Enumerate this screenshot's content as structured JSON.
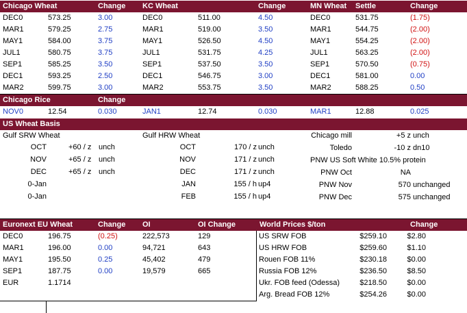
{
  "futures": {
    "headers": [
      "Chicago Wheat",
      "Change",
      "KC Wheat",
      "Change",
      "MN Wheat",
      "Settle",
      "Change"
    ],
    "rows": [
      {
        "cw_m": "DEC0",
        "cw_p": "573.25",
        "cw_c": "3.00",
        "kc_m": "DEC0",
        "kc_p": "511.00",
        "kc_c": "4.50",
        "mn_m": "DEC0",
        "mn_p": "531.75",
        "mn_c": "(1.75)"
      },
      {
        "cw_m": "MAR1",
        "cw_p": "579.25",
        "cw_c": "2.75",
        "kc_m": "MAR1",
        "kc_p": "519.00",
        "kc_c": "3.50",
        "mn_m": "MAR1",
        "mn_p": "544.75",
        "mn_c": "(2.00)"
      },
      {
        "cw_m": "MAY1",
        "cw_p": "584.00",
        "cw_c": "3.75",
        "kc_m": "MAY1",
        "kc_p": "526.50",
        "kc_c": "4.50",
        "mn_m": "MAY1",
        "mn_p": "554.25",
        "mn_c": "(2.00)"
      },
      {
        "cw_m": "JUL1",
        "cw_p": "580.75",
        "cw_c": "3.75",
        "kc_m": "JUL1",
        "kc_p": "531.75",
        "kc_c": "4.25",
        "mn_m": "JUL1",
        "mn_p": "563.25",
        "mn_c": "(2.00)"
      },
      {
        "cw_m": "SEP1",
        "cw_p": "585.25",
        "cw_c": "3.50",
        "kc_m": "SEP1",
        "kc_p": "537.50",
        "kc_c": "3.50",
        "mn_m": "SEP1",
        "mn_p": "570.50",
        "mn_c": "(0.75)"
      },
      {
        "cw_m": "DEC1",
        "cw_p": "593.25",
        "cw_c": "2.50",
        "kc_m": "DEC1",
        "kc_p": "546.75",
        "kc_c": "3.00",
        "mn_m": "DEC1",
        "mn_p": "581.00",
        "mn_c": "0.00"
      },
      {
        "cw_m": "MAR2",
        "cw_p": "599.75",
        "cw_c": "3.00",
        "kc_m": "MAR2",
        "kc_p": "553.75",
        "kc_c": "3.50",
        "mn_m": "MAR2",
        "mn_p": "588.25",
        "mn_c": "0.50"
      }
    ]
  },
  "rice": {
    "headers": [
      "Chicago Rice",
      "Change"
    ],
    "row": [
      "NOV0",
      "12.54",
      "0.030",
      "JAN1",
      "12.74",
      "0.030",
      "MAR1",
      "12.88",
      "0.025"
    ]
  },
  "basis": {
    "title": "US Wheat Basis",
    "gulf_srw_title": "Gulf SRW Wheat",
    "gulf_hrw_title": "Gulf HRW Wheat",
    "srw": [
      [
        "OCT",
        "+60 / z",
        "unch"
      ],
      [
        "NOV",
        "+65 / z",
        "unch"
      ],
      [
        "DEC",
        "+65 / z",
        "unch"
      ],
      [
        "0-Jan",
        "",
        ""
      ],
      [
        "0-Jan",
        "",
        ""
      ]
    ],
    "hrw": [
      [
        "OCT",
        "170 / z",
        "unch"
      ],
      [
        "NOV",
        "171 / z",
        "unch"
      ],
      [
        "DEC",
        "171 / z",
        "unch"
      ],
      [
        "JAN",
        "155 / h",
        "up4"
      ],
      [
        "FEB",
        "155 / h",
        "up4"
      ]
    ],
    "other": [
      {
        "label": "Chicago mill",
        "value": "+5 z",
        "chg": "unch"
      },
      {
        "label": "Toledo",
        "value": "-10 z",
        "chg": "dn10"
      },
      {
        "label": "PNW US Soft White 10.5% protein",
        "value": "",
        "chg": ""
      },
      {
        "label": "PNW Oct",
        "value": "NA",
        "chg": ""
      },
      {
        "label": "PNW Nov",
        "value": "570",
        "chg": "unchanged"
      },
      {
        "label": "PNW Dec",
        "value": "575",
        "chg": "unchanged"
      }
    ]
  },
  "euronext": {
    "headers": [
      "Euronext EU Wheat",
      "Change",
      "OI",
      "OI Change"
    ],
    "rows": [
      [
        "DEC0",
        "196.75",
        "(0.25)",
        "222,573",
        "129"
      ],
      [
        "MAR1",
        "196.00",
        "0.00",
        "94,721",
        "643"
      ],
      [
        "MAY1",
        "195.50",
        "0.25",
        "45,402",
        "479"
      ],
      [
        "SEP1",
        "187.75",
        "0.00",
        "19,579",
        "665"
      ]
    ],
    "eur_label": "EUR",
    "eur_value": "1.1714"
  },
  "world": {
    "headers": [
      "World Prices $/ton",
      "Change"
    ],
    "rows": [
      [
        "US SRW FOB",
        "$259.10",
        "$2.80"
      ],
      [
        "US HRW FOB",
        "$259.60",
        "$1.10"
      ],
      [
        "Rouen FOB 11%",
        "$230.18",
        "$0.00"
      ],
      [
        "Russia FOB 12%",
        "$236.50",
        "$8.50"
      ],
      [
        "Ukr. FOB feed (Odessa)",
        "$218.50",
        "$0.00"
      ],
      [
        "Arg. Bread FOB 12%",
        "$254.26",
        "$0.00"
      ]
    ]
  },
  "colors": {
    "header_bg": "#7b1530",
    "positive": "#1f3ec4",
    "negative": "#d01010"
  }
}
